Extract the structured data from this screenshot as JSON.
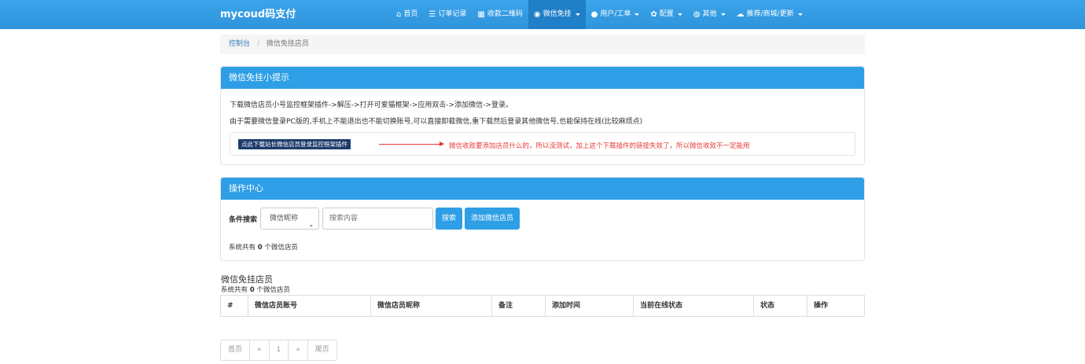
{
  "navbar": {
    "brand": "mycoud码支付",
    "items": [
      {
        "label": "首页",
        "icon": "home-icon",
        "glyph": "⌂",
        "dropdown": false,
        "active": false
      },
      {
        "label": "订单记录",
        "icon": "list-icon",
        "glyph": "☰",
        "dropdown": false,
        "active": false
      },
      {
        "label": "收款二维码",
        "icon": "qrcode-icon",
        "glyph": "▦",
        "dropdown": false,
        "active": false
      },
      {
        "label": "微信免挂",
        "icon": "wechat-icon",
        "glyph": "◉",
        "dropdown": true,
        "active": true
      },
      {
        "label": "用户/工单",
        "icon": "user-icon",
        "glyph": "●",
        "dropdown": true,
        "active": false
      },
      {
        "label": "配置",
        "icon": "gear-icon",
        "glyph": "✿",
        "dropdown": true,
        "active": false
      },
      {
        "label": "其他",
        "icon": "globe-icon",
        "glyph": "◍",
        "dropdown": true,
        "active": false
      },
      {
        "label": "推荐/商城/更新",
        "icon": "cloud-icon",
        "glyph": "☁",
        "dropdown": true,
        "active": false
      }
    ]
  },
  "breadcrumb": {
    "home": "控制台",
    "separator": "/",
    "current": "微信免挂店员"
  },
  "tips_panel": {
    "title": "微信免挂小提示",
    "line1": "下载微信店员小号监控框架插件->解压->打开可爱猫框架->应用双击->添加微信->登录。",
    "line2": "由于需要微信登录PC版的,手机上不能退出也不能切换账号,可以直接卸载微信,重下载然后登录其他微信号,也能保持在线(比较麻烦点)",
    "download_button": "点此下载站长微信店员登录监控框架插件",
    "annotation": "微信收款要添加店员什么的，所以没测试，加上这个下载插件的链接失效了，所以微信收款不一定能用"
  },
  "ops_panel": {
    "title": "操作中心",
    "search_label": "条件搜索",
    "select_value": "微信昵称",
    "search_placeholder": "搜索内容",
    "search_button": "搜索",
    "add_button": "添加微信店员",
    "count_prefix": "系统共有",
    "count": "0",
    "count_suffix": "个微信店员"
  },
  "list": {
    "title": "微信免挂店员",
    "count_prefix": "系统共有",
    "count": "0",
    "count_suffix": "个微信店员",
    "columns": [
      "#",
      "微信店员账号",
      "微信店员昵称",
      "备注",
      "添加时间",
      "当前在线状态",
      "状态",
      "操作"
    ]
  },
  "pagination": [
    "首页",
    "«",
    "1",
    "»",
    "尾页"
  ]
}
